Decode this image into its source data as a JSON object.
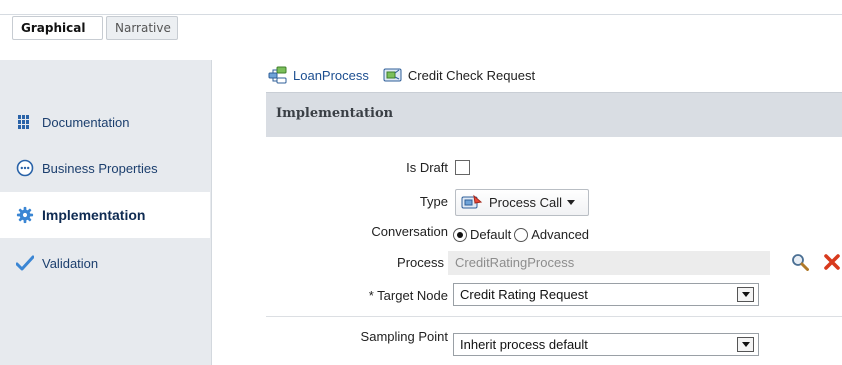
{
  "tabs": [
    {
      "label": "Graphical",
      "active": true
    },
    {
      "label": "Narrative",
      "active": false
    }
  ],
  "sidebar": {
    "items": [
      {
        "label": "Documentation",
        "icon": "documentation-grid-icon"
      },
      {
        "label": "Business Properties",
        "icon": "ellipsis-circle-icon"
      },
      {
        "label": "Implementation",
        "icon": "gear-icon",
        "active": true
      },
      {
        "label": "Validation",
        "icon": "checkmark-icon"
      }
    ]
  },
  "breadcrumb": {
    "process_label": "LoanProcess",
    "activity_label": "Credit Check Request"
  },
  "section": {
    "title": "Implementation"
  },
  "form": {
    "is_draft_label": "Is Draft",
    "is_draft_checked": false,
    "type_label": "Type",
    "type_value": "Process Call",
    "conversation_label": "Conversation",
    "conversation_options": [
      "Default",
      "Advanced"
    ],
    "conversation_selected": "Default",
    "process_label": "Process",
    "process_value": "CreditRatingProcess",
    "target_node_label": "* Target Node",
    "target_node_value": "Credit Rating Request",
    "sampling_point_label": "Sampling Point",
    "sampling_point_value": "Inherit process default"
  },
  "colors": {
    "sidebar_bg": "#e7eaee",
    "header_bg": "#d9dde3",
    "link": "#1d4f91",
    "accent_blue": "#2f79c9",
    "delete_red": "#d83a1d"
  }
}
